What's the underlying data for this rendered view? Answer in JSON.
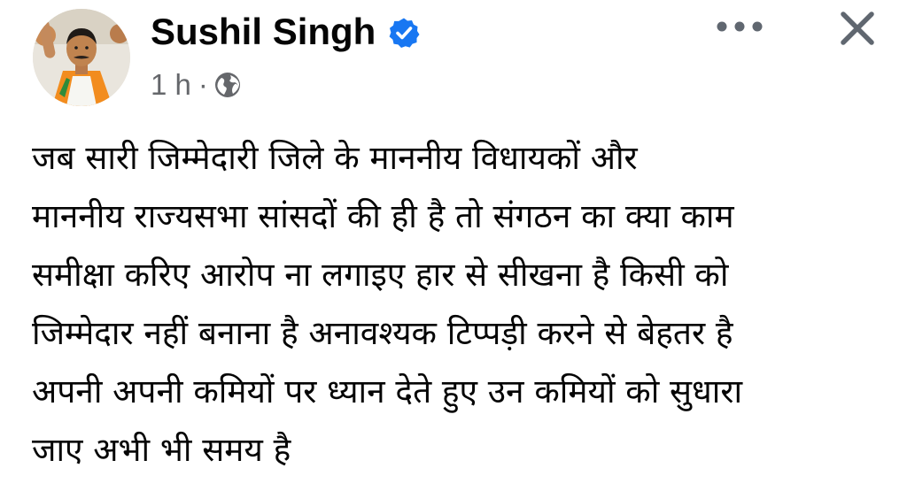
{
  "post": {
    "author": {
      "name": "Sushil Singh",
      "verified": true,
      "avatar_icon": "profile-photo"
    },
    "meta": {
      "time": "1 h",
      "separator": "·",
      "audience_icon": "globe-icon"
    },
    "actions": {
      "more_icon": "more-options-icon",
      "close_icon": "close-icon"
    },
    "body_lines": [
      "जब सारी जिम्मेदारी जिले के माननीय विधायकों और",
      "माननीय राज्यसभा सांसदों की ही है तो संगठन का क्या काम",
      "समीक्षा करिए आरोप ना लगाइए हार से सीखना है किसी को",
      "जिम्मेदार नहीं बनाना है अनावश्यक टिप्पड़ी करने से बेहतर है",
      "अपनी अपनी कमियों पर ध्यान देते हुए उन कमियों को सुधारा",
      "जाए अभी भी समय है"
    ]
  },
  "colors": {
    "text": "#050505",
    "secondary_text": "#65676b",
    "verified_badge": "#1877f2",
    "icon_gray": "#606770"
  }
}
